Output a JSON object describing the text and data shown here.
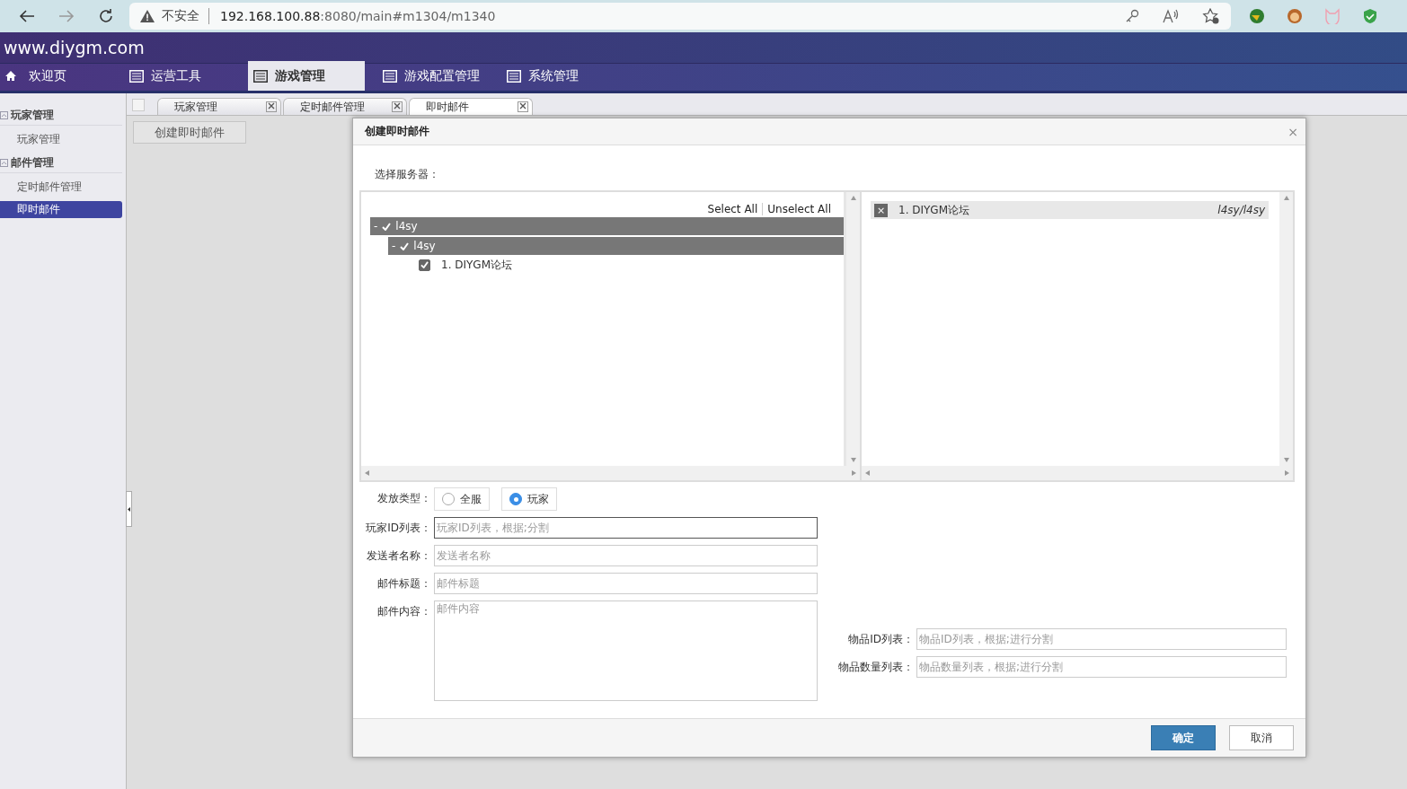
{
  "browser": {
    "security": "不安全",
    "url_host": "192.168.100.88",
    "url_path": ":8080/main#m1304/m1340"
  },
  "site": {
    "title": "www.diygm.com"
  },
  "nav": [
    {
      "label": "欢迎页",
      "kind": "home",
      "selected": false
    },
    {
      "label": "运营工具",
      "kind": "list",
      "selected": false
    },
    {
      "label": "游戏管理",
      "kind": "list",
      "selected": true
    },
    {
      "label": "游戏配置管理",
      "kind": "list",
      "selected": false
    },
    {
      "label": "系统管理",
      "kind": "list",
      "selected": false
    }
  ],
  "sidebar": [
    {
      "label": "玩家管理",
      "expanded": true,
      "items": [
        {
          "label": "玩家管理",
          "selected": false
        }
      ]
    },
    {
      "label": "邮件管理",
      "expanded": true,
      "items": [
        {
          "label": "定时邮件管理",
          "selected": false
        },
        {
          "label": "即时邮件",
          "selected": true
        }
      ]
    }
  ],
  "tabs": [
    {
      "label": "玩家管理",
      "selected": false
    },
    {
      "label": "定时邮件管理",
      "selected": false
    },
    {
      "label": "即时邮件",
      "selected": true
    }
  ],
  "toolbar": {
    "create_button": "创建即时邮件"
  },
  "dialog": {
    "title": "创建即时邮件",
    "close": "×",
    "server_label": "选择服务器：",
    "select_all": "Select All",
    "unselect_all": "Unselect All",
    "tree": [
      {
        "toggle": "-",
        "label": "l4sy",
        "checked": true,
        "children": [
          {
            "toggle": "-",
            "label": "l4sy",
            "checked": true,
            "children": [
              {
                "label": "1. DIYGM论坛",
                "checked": true
              }
            ]
          }
        ]
      }
    ],
    "selected_servers": [
      {
        "remove": "×",
        "name": "1. DIYGM论坛",
        "path": "l4sy/l4sy"
      }
    ],
    "send_type": {
      "label": "发放类型：",
      "options": [
        {
          "label": "全服",
          "selected": false
        },
        {
          "label": "玩家",
          "selected": true
        }
      ]
    },
    "fields": [
      {
        "label": "玩家ID列表：",
        "placeholder": "玩家ID列表，根据;分割",
        "kind": "input",
        "focused": true
      },
      {
        "label": "发送者名称：",
        "placeholder": "发送者名称",
        "kind": "input",
        "focused": false
      },
      {
        "label": "邮件标题：",
        "placeholder": "邮件标题",
        "kind": "input",
        "focused": false
      },
      {
        "label": "邮件内容：",
        "placeholder": "邮件内容",
        "kind": "textarea",
        "focused": false
      }
    ],
    "item_fields": [
      {
        "label": "物品ID列表：",
        "placeholder": "物品ID列表，根据;进行分割"
      },
      {
        "label": "物品数量列表：",
        "placeholder": "物品数量列表，根据;进行分割"
      }
    ],
    "confirm": "确定",
    "cancel": "取消"
  }
}
